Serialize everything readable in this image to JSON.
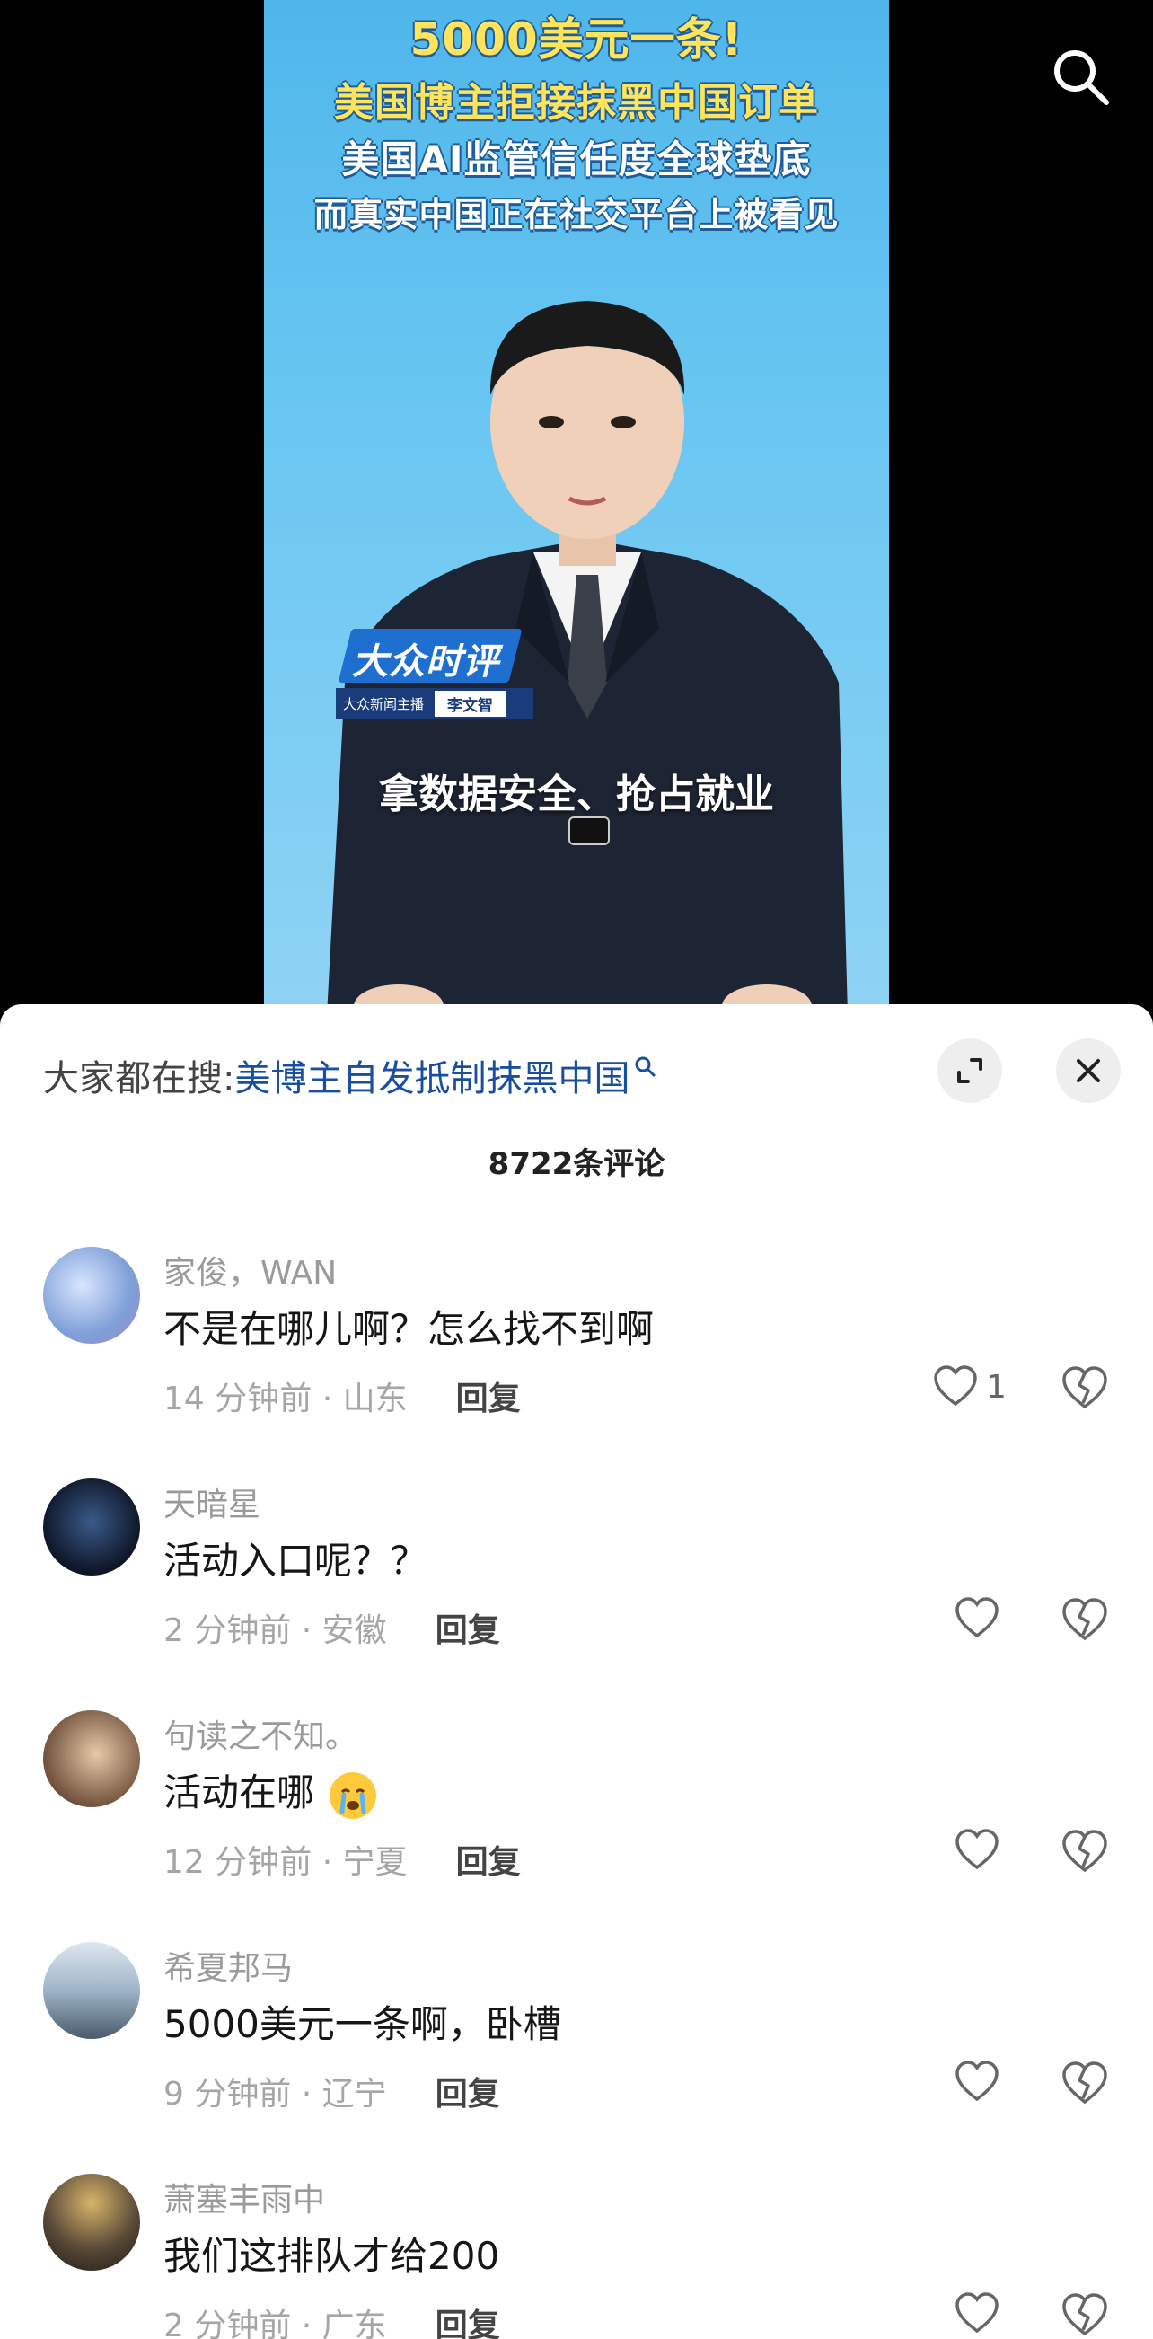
{
  "video": {
    "headline_lines": [
      "5000美元一条!",
      "美国博主拒接抹黑中国订单",
      "美国AI监管信任度全球垫底",
      "而真实中国正在社交平台上被看见"
    ],
    "brand_name": "大众时评",
    "brand_subtitle": "大众新闻主播",
    "anchor_name": "李文智",
    "caption": "拿数据安全、抢占就业"
  },
  "top_icons": {
    "search": "search-icon"
  },
  "sheet": {
    "search_prefix": "大家都在搜:",
    "search_term": "美博主自发抵制抹黑中国",
    "comment_count": "8722条评论",
    "expand_icon": "expand-icon",
    "close_icon": "close-icon"
  },
  "comments": [
    {
      "user": "家俊，WAN",
      "text": "不是在哪儿啊？怎么找不到啊",
      "meta": "14 分钟前 · 山东",
      "reply": "回复",
      "likes": "1",
      "avatar_color": "#8fb4e8"
    },
    {
      "user": "天暗星",
      "text": "活动入口呢？？",
      "meta": "2 分钟前 · 安徽",
      "reply": "回复",
      "likes": "",
      "avatar_color": "#1a2a44"
    },
    {
      "user": "句读之不知。",
      "text": "活动在哪",
      "meta": "12 分钟前 · 宁夏",
      "reply": "回复",
      "likes": "",
      "avatar_color": "#a6846a",
      "emoji": "crying-emoji"
    },
    {
      "user": "希夏邦马",
      "text": "5000美元一条啊，卧槽",
      "meta": "9 分钟前 · 辽宁",
      "reply": "回复",
      "likes": "",
      "avatar_color": "#b9c8d8"
    },
    {
      "user": "萧塞丰雨中",
      "text": "我们这排队才给200",
      "meta": "2 分钟前 · 广东",
      "reply": "回复",
      "likes": "",
      "avatar_color": "#4a4438"
    }
  ],
  "colors": {
    "accent_link": "#1a4fa0",
    "headline_yellow": "#ffe45c",
    "video_blue": "#5bbcec"
  }
}
